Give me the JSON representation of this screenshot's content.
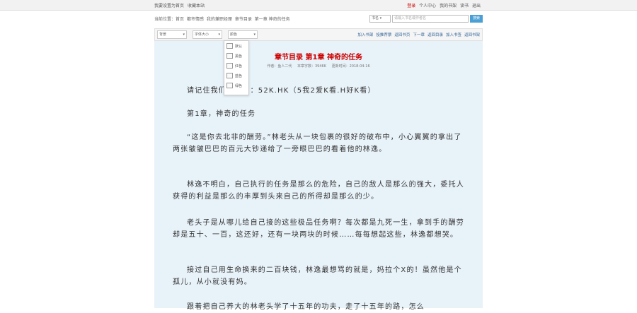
{
  "topbar": {
    "left": [
      "我要设置为首页",
      "收藏本站"
    ],
    "right": [
      "登录",
      "个人中心",
      "我的书架",
      "读书",
      "退出"
    ]
  },
  "breadcrumb": [
    "当前位置：首页",
    "都市情感",
    "我的兼职经理",
    "章节目录",
    "第一章  神奇的任务"
  ],
  "search": {
    "select_label": "书名 ▾",
    "placeholder": "请输入书名或作者名",
    "button": "搜索"
  },
  "toolbar": {
    "selects": [
      "背景",
      "字体大小",
      "颜色"
    ],
    "links": [
      "加入书架",
      "投推荐票",
      "返回书页",
      "下一章",
      "返回目录",
      "加入书签",
      "返回书架"
    ]
  },
  "color_dropdown": [
    "默认",
    "黑色",
    "红色",
    "蓝色",
    "绿色"
  ],
  "chapter": {
    "title": "章节目录  第1章  神奇的任务",
    "meta": [
      "作者：鱼人二代",
      "本章字数：3946K",
      "更新时间：2018-04-16"
    ]
  },
  "paragraphs": [
    "请记住我们的网址：52K.HK（5我2爱K看.H好K看）",
    "第1章，神奇的任务",
    "“这是你去北非的酬劳。”林老头从一块包裹的很好的破布中，小心翼翼的拿出了两张皱皱巴巴的百元大钞递给了一旁眼巴巴的看着他的林逸。",
    "林逸不明白，自己执行的任务是那么的危险，自己的敌人是那么的强大，委托人获得的利益是那么的丰厚到头来自己的所得却是那么的少。",
    "老头子是从哪儿给自己接的这些极品任务啊？每次都是九死一生，拿到手的酬劳却是五十、一百，这还好，还有一块两块的时候……每每想起这些，林逸都想哭。",
    "接过自己用生命换来的二百块钱，林逸最想骂的就是，妈拉个X的！虽然他是个孤儿，从小就没有妈。",
    "跟着把自己养大的林老头学了十五年的功夫，走了十五年的路，怎么"
  ]
}
